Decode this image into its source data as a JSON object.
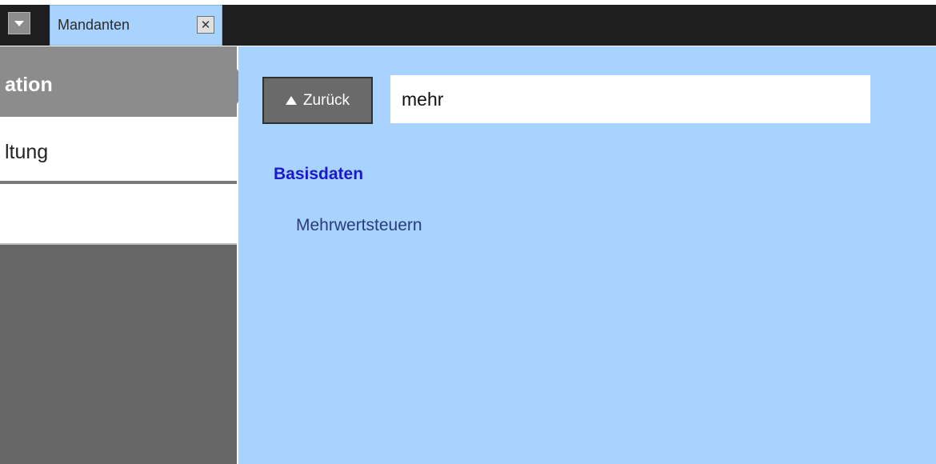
{
  "tabstrip": {
    "tab": {
      "label": "Mandanten",
      "close_glyph": "✕"
    },
    "icons": {
      "dropdown": "chevron-down-icon",
      "close": "close-icon"
    }
  },
  "nav": {
    "header_label": "ation",
    "item_label": "ltung"
  },
  "content": {
    "back_button": {
      "label": "Zurück",
      "icon": "triangle-up-icon"
    },
    "search": {
      "value": "mehr"
    },
    "results": {
      "section_title": "Basisdaten",
      "items": [
        "Mehrwertsteuern"
      ]
    }
  },
  "colors": {
    "content_bg": "#a9d3ff",
    "tab_bg": "#a9d3ff",
    "tabstrip_bg": "#1e1e1e",
    "nav_header_bg": "#8c8c8c",
    "nav_lower_bg": "#666666",
    "section_title": "#1a1acc",
    "result_item": "#2a3b7a"
  }
}
